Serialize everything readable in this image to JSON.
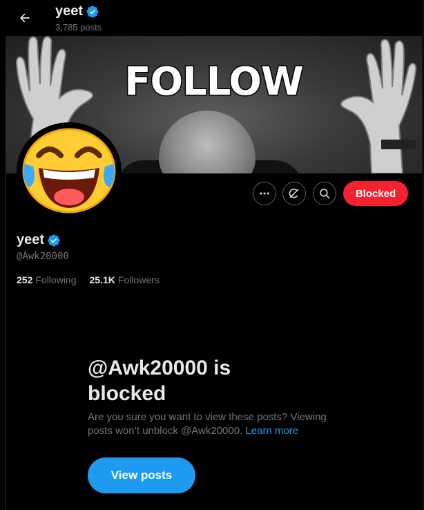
{
  "header": {
    "display_name": "yeet",
    "post_count": "3,785 posts",
    "back_icon": "arrow-left-icon",
    "verified_icon": "verified-badge-icon"
  },
  "banner": {
    "caption": "FOLLOW"
  },
  "avatar": {
    "icon": "tears-of-joy-emoji"
  },
  "actions": {
    "more_icon": "more-horizontal-icon",
    "grok_icon": "grok-icon",
    "search_icon": "search-icon",
    "blocked_label": "Blocked"
  },
  "profile": {
    "display_name": "yeet",
    "handle": "@Awk20000",
    "following_count": "252",
    "following_label": "Following",
    "followers_count": "25.1K",
    "followers_label": "Followers"
  },
  "blocked_notice": {
    "title": "@Awk20000 is blocked",
    "description": "Are you sure you want to view these posts? Viewing posts won’t unblock @Awk20000.",
    "learn_more": "Learn more",
    "view_button": "View posts"
  },
  "colors": {
    "accent": "#1d9bf0",
    "blocked_red": "#f4212e",
    "background": "#000000",
    "muted_text": "#71767b"
  }
}
